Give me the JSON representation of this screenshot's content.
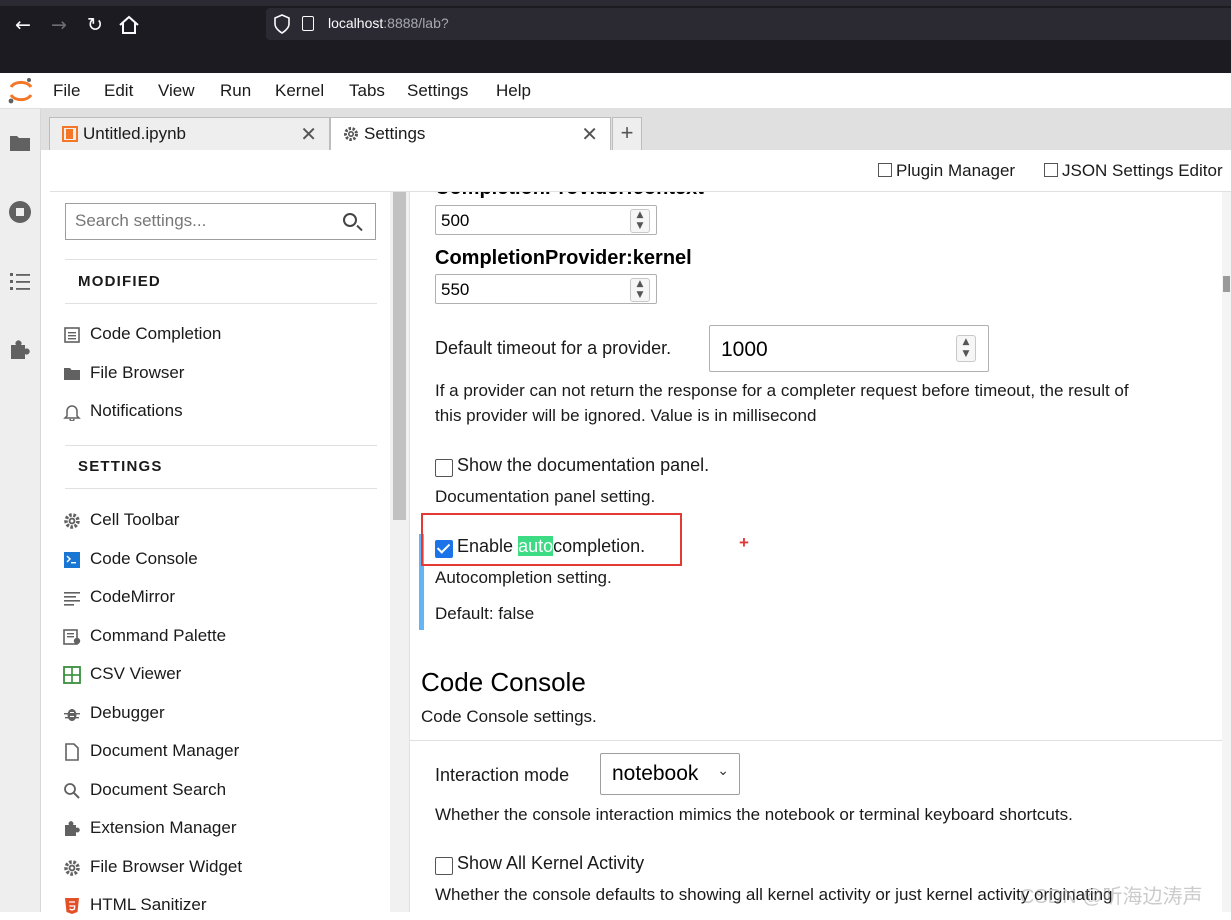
{
  "browser": {
    "url_host": "localhost",
    "url_rest": ":8888/lab?"
  },
  "menubar": {
    "items": [
      "File",
      "Edit",
      "View",
      "Run",
      "Kernel",
      "Tabs",
      "Settings",
      "Help"
    ]
  },
  "tabs": [
    {
      "label": "Untitled.ipynb",
      "close": "✕"
    },
    {
      "label": "Settings",
      "close": "✕"
    }
  ],
  "new_tab_label": "+",
  "toolbar": {
    "plugin_manager": "Plugin Manager",
    "json_editor": "JSON Settings Editor"
  },
  "sidebar": {
    "search_placeholder": "Search settings...",
    "modified_heading": "MODIFIED",
    "settings_heading": "SETTINGS",
    "modified_items": [
      {
        "label": "Code Completion",
        "icon": "list-icon"
      },
      {
        "label": "File Browser",
        "icon": "folder-icon"
      },
      {
        "label": "Notifications",
        "icon": "bell-icon"
      }
    ],
    "settings_items": [
      {
        "label": "Cell Toolbar",
        "icon": "gear-icon"
      },
      {
        "label": "Code Console",
        "icon": "console-icon"
      },
      {
        "label": "CodeMirror",
        "icon": "lines-icon"
      },
      {
        "label": "Command Palette",
        "icon": "palette-icon"
      },
      {
        "label": "CSV Viewer",
        "icon": "grid-icon"
      },
      {
        "label": "Debugger",
        "icon": "bug-icon"
      },
      {
        "label": "Document Manager",
        "icon": "file-icon"
      },
      {
        "label": "Document Search",
        "icon": "search-icon"
      },
      {
        "label": "Extension Manager",
        "icon": "puzzle-icon"
      },
      {
        "label": "File Browser Widget",
        "icon": "gear-icon"
      },
      {
        "label": "HTML Sanitizer",
        "icon": "html5-icon"
      }
    ]
  },
  "panel": {
    "context_title": "CompletionProvider:context",
    "context_value": "500",
    "kernel_title": "CompletionProvider:kernel",
    "kernel_value": "550",
    "timeout_label": "Default timeout for a provider.",
    "timeout_value": "1000",
    "timeout_desc_1": "If a provider can not return the response for a completer request before timeout, the result of",
    "timeout_desc_2": "this provider will be ignored. Value is in millisecond",
    "doc_panel_label": "Show the documentation panel.",
    "doc_panel_checked": false,
    "doc_panel_desc": "Documentation panel setting.",
    "autocomplete_pre": "Enable ",
    "autocomplete_hl": "auto",
    "autocomplete_post": "completion.",
    "autocomplete_checked": true,
    "autocomplete_desc": "Autocompletion setting.",
    "autocomplete_default": "Default: false",
    "annotation_mark": "+",
    "console_section_title": "Code Console",
    "console_section_desc": "Code Console settings.",
    "interaction_label": "Interaction mode",
    "interaction_value": "notebook",
    "interaction_desc": "Whether the console interaction mimics the notebook or terminal keyboard shortcuts.",
    "kernel_activity_label": "Show All Kernel Activity",
    "kernel_activity_checked": false,
    "kernel_activity_desc": "Whether the console defaults to showing all kernel activity or just kernel activity originating"
  },
  "watermark": "CSDN @听海边涛声",
  "colors": {
    "accent": "#1a73e8",
    "jupyter_orange": "#f37726",
    "highlight": "#3ddc84",
    "annotation_red": "#e53935",
    "modified_bar": "#64b5f6"
  }
}
